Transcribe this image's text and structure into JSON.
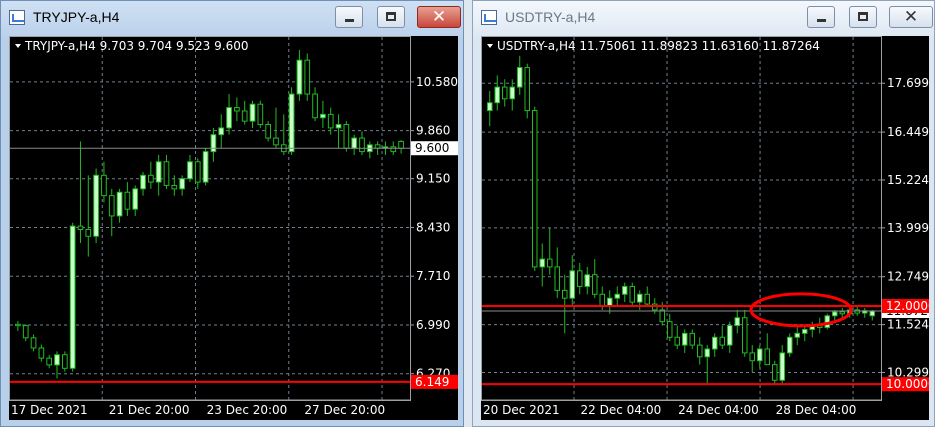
{
  "windows": [
    {
      "title": "TRYJPY-a,H4",
      "active": true
    },
    {
      "title": "USDTRY-a,H4",
      "active": false
    }
  ],
  "colors": {
    "bull": "#c8ffc8",
    "bear": "#22bb22",
    "wick": "#22bb22",
    "grid": "#708090",
    "level": "#ff0000",
    "axis_text": "#ffffff"
  },
  "chart_data": [
    {
      "type": "candlestick",
      "symbol": "TRYJPY-a,H4",
      "header": "TRYJPY-a,H4  9.703 9.704 9.523 9.600",
      "ylim": [
        6.0,
        11.08
      ],
      "y_ticks": [
        10.58,
        9.86,
        9.15,
        8.43,
        7.71,
        6.99,
        6.27
      ],
      "y_tick_labels": [
        "10.580",
        "9.860",
        "9.150",
        "8.430",
        "7.710",
        "6.990",
        "6.270"
      ],
      "x_tick_labels": [
        "17 Dec 2021",
        "21 Dec 20:00",
        "23 Dec 20:00",
        "27 Dec 20:00"
      ],
      "bid_label": "9.600",
      "bid_value": 9.6,
      "levels": [
        {
          "value": 6.149,
          "label": "6.149"
        }
      ],
      "candles": [
        [
          7.0,
          7.05,
          6.9,
          6.98
        ],
        [
          6.98,
          7.0,
          6.75,
          6.8
        ],
        [
          6.8,
          6.85,
          6.6,
          6.65
        ],
        [
          6.65,
          6.7,
          6.45,
          6.5
        ],
        [
          6.5,
          6.55,
          6.35,
          6.4
        ],
        [
          6.4,
          6.6,
          6.2,
          6.55
        ],
        [
          6.55,
          6.6,
          6.3,
          6.35
        ],
        [
          6.35,
          8.5,
          6.3,
          8.45
        ],
        [
          8.45,
          9.7,
          8.2,
          8.4
        ],
        [
          8.4,
          9.2,
          8.0,
          8.3
        ],
        [
          8.3,
          9.3,
          8.2,
          9.2
        ],
        [
          9.2,
          9.4,
          8.8,
          8.9
        ],
        [
          8.9,
          9.0,
          8.3,
          8.6
        ],
        [
          8.6,
          9.0,
          8.5,
          8.95
        ],
        [
          8.95,
          9.1,
          8.6,
          8.7
        ],
        [
          8.7,
          9.05,
          8.6,
          9.0
        ],
        [
          9.0,
          9.25,
          8.9,
          9.2
        ],
        [
          9.2,
          9.4,
          9.0,
          9.1
        ],
        [
          9.1,
          9.5,
          8.9,
          9.4
        ],
        [
          9.4,
          9.5,
          9.0,
          9.05
        ],
        [
          9.05,
          9.2,
          8.9,
          9.0
        ],
        [
          9.0,
          9.2,
          8.9,
          9.15
        ],
        [
          9.15,
          9.5,
          9.1,
          9.4
        ],
        [
          9.4,
          9.45,
          9.0,
          9.1
        ],
        [
          9.1,
          9.6,
          9.05,
          9.55
        ],
        [
          9.55,
          9.9,
          9.4,
          9.8
        ],
        [
          9.8,
          10.1,
          9.6,
          9.9
        ],
        [
          9.9,
          10.4,
          9.8,
          10.2
        ],
        [
          10.2,
          10.35,
          10.0,
          10.15
        ],
        [
          10.15,
          10.3,
          9.95,
          10.0
        ],
        [
          10.0,
          10.3,
          9.9,
          10.25
        ],
        [
          10.25,
          10.3,
          9.9,
          9.95
        ],
        [
          9.95,
          10.0,
          9.7,
          9.75
        ],
        [
          9.75,
          10.2,
          9.6,
          9.65
        ],
        [
          9.65,
          10.1,
          9.5,
          9.55
        ],
        [
          9.55,
          10.5,
          9.5,
          10.4
        ],
        [
          10.4,
          11.05,
          10.3,
          10.9
        ],
        [
          10.9,
          11.0,
          10.3,
          10.4
        ],
        [
          10.4,
          10.5,
          10.0,
          10.05
        ],
        [
          10.05,
          10.3,
          9.9,
          10.1
        ],
        [
          10.1,
          10.2,
          9.8,
          9.9
        ],
        [
          9.9,
          10.1,
          9.6,
          9.95
        ],
        [
          9.95,
          10.0,
          9.55,
          9.6
        ],
        [
          9.6,
          9.8,
          9.5,
          9.75
        ],
        [
          9.75,
          9.85,
          9.5,
          9.55
        ],
        [
          9.55,
          9.7,
          9.45,
          9.65
        ],
        [
          9.65,
          9.7,
          9.5,
          9.6
        ],
        [
          9.6,
          9.7,
          9.5,
          9.62
        ],
        [
          9.62,
          9.7,
          9.5,
          9.55
        ],
        [
          9.7,
          9.72,
          9.52,
          9.6
        ]
      ]
    },
    {
      "type": "candlestick",
      "symbol": "USDTRY-a,H4",
      "header": "USDTRY-a,H4  11.75061 11.89823 11.63160 11.87264",
      "ylim": [
        9.8,
        18.6
      ],
      "y_ticks": [
        17.6992,
        16.4492,
        15.2242,
        13.9992,
        12.7492,
        11.5242,
        10.2992
      ],
      "y_tick_labels": [
        "17.69920",
        "16.44920",
        "15.22420",
        "13.99920",
        "12.74920",
        "11.52420",
        "10.29920"
      ],
      "x_tick_labels": [
        "20 Dec 2021",
        "22 Dec 04:00",
        "24 Dec 04:00",
        "28 Dec 04:00"
      ],
      "bid_label": "11.87264",
      "bid_value": 11.87264,
      "levels": [
        {
          "value": 12.0,
          "label": "12.00000"
        },
        {
          "value": 10.0,
          "label": "10.00000"
        }
      ],
      "candles": [
        [
          17.0,
          17.5,
          16.6,
          17.2
        ],
        [
          17.2,
          17.9,
          17.0,
          17.6
        ],
        [
          17.6,
          17.8,
          17.1,
          17.3
        ],
        [
          17.3,
          17.8,
          17.0,
          17.6
        ],
        [
          17.6,
          18.4,
          17.4,
          18.1
        ],
        [
          18.1,
          18.2,
          16.8,
          17.0
        ],
        [
          17.0,
          17.1,
          12.9,
          13.0
        ],
        [
          13.0,
          13.6,
          12.5,
          13.2
        ],
        [
          13.2,
          14.0,
          12.8,
          13.0
        ],
        [
          13.0,
          13.5,
          12.2,
          12.4
        ],
        [
          12.4,
          12.8,
          11.3,
          12.2
        ],
        [
          12.2,
          13.3,
          12.0,
          12.9
        ],
        [
          12.9,
          13.1,
          12.3,
          12.5
        ],
        [
          12.5,
          13.0,
          12.3,
          12.8
        ],
        [
          12.8,
          13.2,
          12.2,
          12.3
        ],
        [
          12.3,
          12.5,
          11.9,
          12.0
        ],
        [
          12.0,
          12.4,
          11.8,
          12.2
        ],
        [
          12.2,
          12.5,
          12.0,
          12.3
        ],
        [
          12.3,
          12.6,
          12.1,
          12.5
        ],
        [
          12.5,
          12.6,
          12.0,
          12.1
        ],
        [
          12.1,
          12.4,
          11.9,
          12.3
        ],
        [
          12.3,
          12.5,
          12.0,
          12.05
        ],
        [
          12.05,
          12.2,
          11.8,
          11.9
        ],
        [
          11.9,
          12.1,
          11.5,
          11.6
        ],
        [
          11.6,
          11.8,
          11.1,
          11.2
        ],
        [
          11.2,
          11.5,
          10.9,
          11.0
        ],
        [
          11.0,
          11.4,
          10.8,
          11.3
        ],
        [
          11.3,
          11.4,
          10.9,
          11.0
        ],
        [
          11.0,
          11.2,
          10.5,
          10.7
        ],
        [
          10.7,
          11.0,
          10.0,
          10.9
        ],
        [
          10.9,
          11.3,
          10.7,
          11.2
        ],
        [
          11.2,
          11.5,
          10.9,
          11.0
        ],
        [
          11.0,
          11.6,
          10.8,
          11.5
        ],
        [
          11.5,
          11.9,
          11.3,
          11.7
        ],
        [
          11.7,
          11.9,
          10.7,
          10.8
        ],
        [
          10.8,
          11.0,
          10.3,
          10.6
        ],
        [
          10.6,
          11.0,
          10.4,
          10.9
        ],
        [
          10.9,
          11.3,
          10.7,
          10.5
        ],
        [
          10.5,
          10.6,
          10.0,
          10.1
        ],
        [
          10.1,
          11.0,
          10.0,
          10.8
        ],
        [
          10.8,
          11.3,
          10.7,
          11.2
        ],
        [
          11.2,
          11.5,
          11.0,
          11.3
        ],
        [
          11.3,
          11.5,
          11.1,
          11.4
        ],
        [
          11.4,
          11.6,
          11.2,
          11.5
        ],
        [
          11.5,
          11.7,
          11.3,
          11.45
        ],
        [
          11.45,
          11.8,
          11.4,
          11.75
        ],
        [
          11.75,
          11.9,
          11.6,
          11.85
        ],
        [
          11.85,
          11.95,
          11.7,
          11.8
        ],
        [
          11.8,
          11.95,
          11.7,
          11.9
        ],
        [
          11.9,
          11.98,
          11.75,
          11.82
        ],
        [
          11.82,
          11.95,
          11.7,
          11.88
        ],
        [
          11.75,
          11.9,
          11.63,
          11.87
        ]
      ]
    }
  ]
}
